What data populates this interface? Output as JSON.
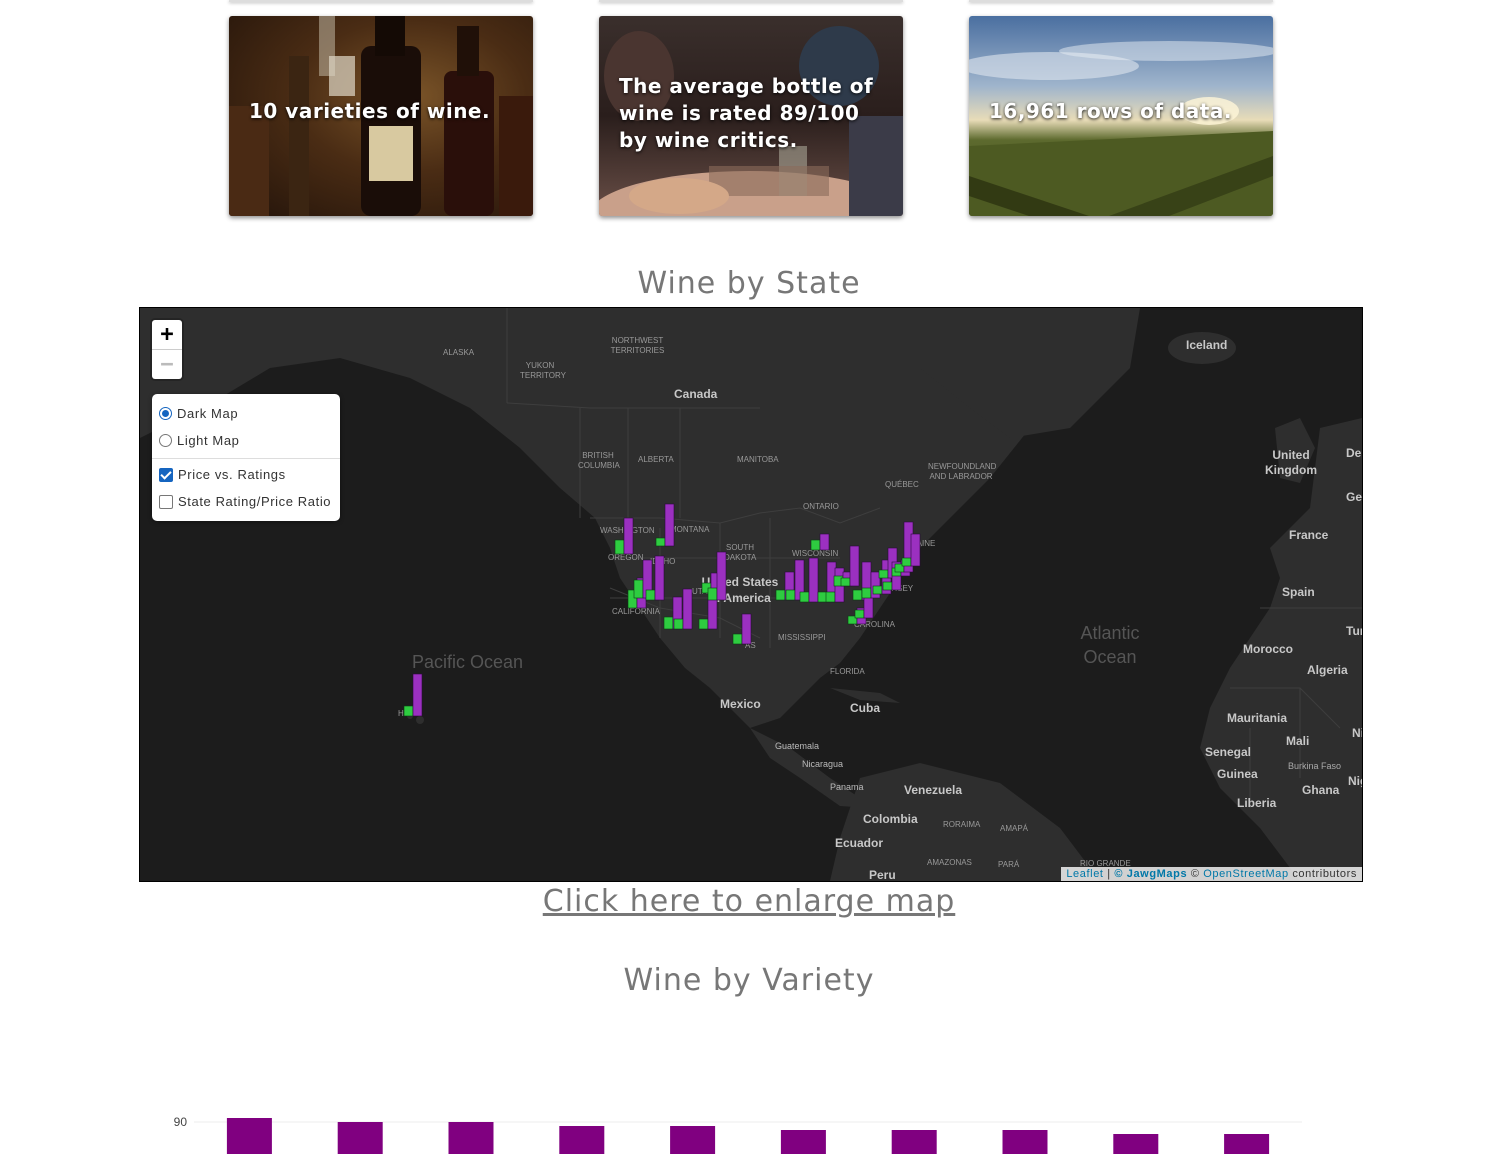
{
  "cards": [
    {
      "text": "10 varieties of wine."
    },
    {
      "text": "The average bottle of wine is rated 89/100 by wine critics."
    },
    {
      "text": "16,961 rows of data."
    }
  ],
  "map_section": {
    "title": "Wine by State",
    "zoom_in": "+",
    "zoom_out": "−",
    "layers": {
      "base": [
        {
          "label": "Dark Map",
          "selected": true
        },
        {
          "label": "Light Map",
          "selected": false
        }
      ],
      "overlays": [
        {
          "label": "Price vs. Ratings",
          "checked": true
        },
        {
          "label": "State Rating/Price Ratio",
          "checked": false
        }
      ]
    },
    "attribution": {
      "leaflet": "Leaflet",
      "sep": " | ",
      "copy1": "© ",
      "jawg": "JawgMaps",
      "copy2": " © ",
      "osm": "OpenStreetMap",
      "contrib": " contributors"
    },
    "labels": {
      "alaska": "ALASKA",
      "yukon": "YUKON TERRITORY",
      "nwt": "NORTHWEST TERRITORIES",
      "canada": "Canada",
      "iceland": "Iceland",
      "bc": "BRITISH COLUMBIA",
      "alberta": "ALBERTA",
      "manitoba": "MANITOBA",
      "newfoundland": "NEWFOUNDLAND AND LABRADOR",
      "quebec": "QUÉBEC",
      "ontario": "ONTARIO",
      "uk": "United Kingdom",
      "germany": "Ger",
      "france": "France",
      "spain": "Spain",
      "den": "Den",
      "morocco": "Morocco",
      "algeria": "Algeria",
      "tunisia": "Tun",
      "mauritania": "Mauritania",
      "mali": "Mali",
      "senegal": "Senegal",
      "guinea": "Guinea",
      "burkina": "Burkina Faso",
      "ghana": "Ghana",
      "niger": "Nig",
      "nigeria": "Niger",
      "liberia": "Liberia",
      "atlantic": "Atlantic Ocean",
      "pacific": "Pacific Ocean",
      "us": "United States of America",
      "mexico": "Mexico",
      "cuba": "Cuba",
      "guatemala": "Guatemala",
      "nicaragua": "Nicaragua",
      "panama": "Panama",
      "venezuela": "Venezuela",
      "colombia": "Colombia",
      "ecuador": "Ecuador",
      "peru": "Peru",
      "roraima": "RORAIMA",
      "amapa": "AMAPÁ",
      "amazonas": "AMAZONAS",
      "para": "PARÁ",
      "riogrande": "RIO GRANDE",
      "washington": "WASHINGTON",
      "oregon": "OREGON",
      "idaho": "IDAHO",
      "montana": "MONTANA",
      "southdakota": "SOUTH DAKOTA",
      "utah": "UTAH",
      "california": "CALIFORNIA",
      "mississippi": "MISSISSIPPI",
      "florida": "FLORIDA",
      "wisconsin": "WISCONSIN",
      "maine": "MAINE",
      "jersey": "JERSEY",
      "ncarolina": "CAROLINA",
      "texas": "AS",
      "hawaii": "H"
    },
    "bar_colors": {
      "price": "#2ecc40",
      "rating": "#9b30c0"
    }
  },
  "enlarge_link": "Click here to enlarge map",
  "variety_section": {
    "title": "Wine by Variety"
  },
  "chart_data": {
    "type": "bar",
    "categories": [
      "",
      "",
      "",
      "",
      "",
      "",
      "",
      "",
      "",
      ""
    ],
    "values": [
      90.1,
      90.0,
      90.0,
      89.9,
      89.9,
      89.8,
      89.8,
      89.8,
      89.7,
      89.7
    ],
    "yticks": [
      90
    ],
    "color": "#800080"
  }
}
